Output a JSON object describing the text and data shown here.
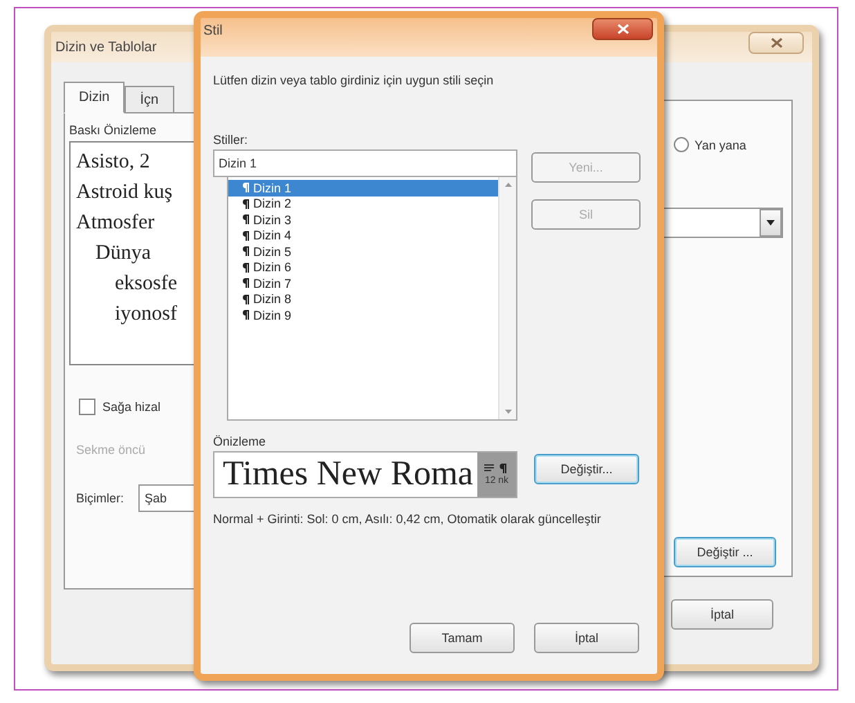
{
  "back_window": {
    "title": "Dizin ve Tablolar",
    "tabs": [
      {
        "label": "Dizin",
        "selected": true
      },
      {
        "label": "İçn",
        "selected": false
      }
    ],
    "preview_label": "Baskı Önizleme",
    "preview_entries": [
      {
        "text": "Asisto, 2"
      },
      {
        "text": "Astroid kuş"
      },
      {
        "text": "Atmosfer",
        "children": [
          {
            "text": "Dünya",
            "children": [
              {
                "text": "eksosfe"
              },
              {
                "text": "iyonosf"
              }
            ]
          }
        ]
      }
    ],
    "right_align": {
      "label": "Sağa hizal",
      "checked": false
    },
    "tab_leader": {
      "label": "Sekme öncü",
      "disabled": true
    },
    "formats": {
      "label": "Biçimler:",
      "value": "Şab"
    },
    "side_by_side": {
      "label": "Yan yana",
      "selected": false
    },
    "modify_button": "Değiştir ...",
    "cancel_button": "İptal"
  },
  "style_dialog": {
    "title": "Stil",
    "prompt": "Lütfen dizin veya tablo girdiniz için uygun stili seçin",
    "styles_label": "Stiller:",
    "style_name": "Dizin 1",
    "styles": [
      {
        "label": "Dizin 1",
        "selected": true
      },
      {
        "label": "Dizin 2",
        "selected": false
      },
      {
        "label": "Dizin 3",
        "selected": false
      },
      {
        "label": "Dizin 4",
        "selected": false
      },
      {
        "label": "Dizin 5",
        "selected": false
      },
      {
        "label": "Dizin 6",
        "selected": false
      },
      {
        "label": "Dizin 7",
        "selected": false
      },
      {
        "label": "Dizin 8",
        "selected": false
      },
      {
        "label": "Dizin 9",
        "selected": false
      }
    ],
    "side_buttons": [
      {
        "label": "Yeni...",
        "disabled": true
      },
      {
        "label": "Sil",
        "disabled": true
      }
    ],
    "preview_label": "Önizleme",
    "preview_text": "Times New Roma",
    "preview_size": "12 nk",
    "modify_button": "Değiştir...",
    "description": "Normal + Girinti: Sol:  0 cm, Asılı:  0,42 cm, Otomatik olarak güncelleştir",
    "ok_button": "Tamam",
    "cancel_button": "İptal"
  }
}
